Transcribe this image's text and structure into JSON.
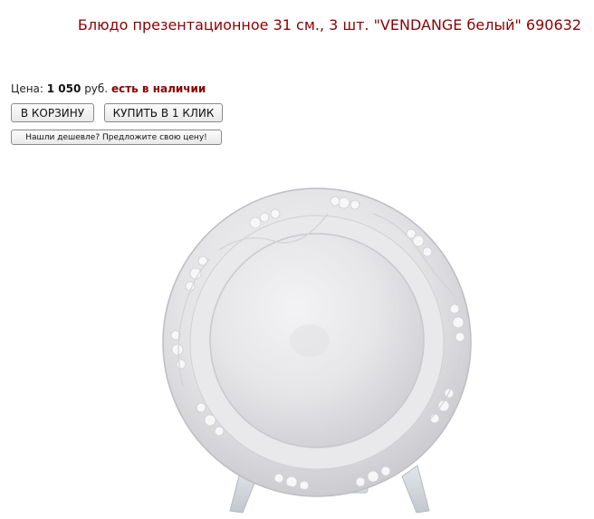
{
  "product": {
    "title": "Блюдо презентационное 31 см., 3 шт. \"VENDANGE белый\" 690632",
    "price_label": "Цена:",
    "price_value": "1 050",
    "currency": "руб.",
    "availability": "есть в наличии",
    "image_alt": "plate-icon"
  },
  "actions": {
    "add_to_cart": "В КОРЗИНУ",
    "buy_one_click": "КУПИТЬ В 1 КЛИК",
    "found_cheaper": "Нашли дешевле? Предложите свою цену!"
  },
  "colors": {
    "title": "#8b0000",
    "availability": "#8b0000",
    "plate": "#e8e8ea"
  }
}
